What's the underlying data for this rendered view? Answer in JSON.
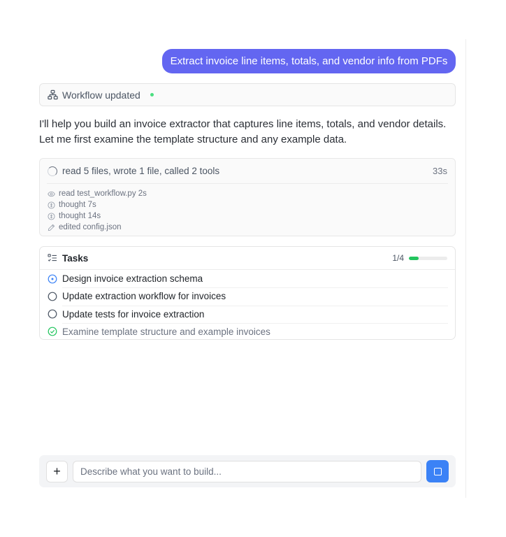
{
  "conversation": {
    "user_message": "Extract invoice line items, totals, and vendor info from PDFs",
    "workflow_status": {
      "label": "Workflow updated",
      "icon": "workflow-icon",
      "status_color": "#4ade80"
    },
    "assistant_message": "I'll help you build an invoice extractor that captures line items, totals, and vendor details. Let me first examine the template structure and any example data."
  },
  "activity": {
    "summary": "read 5 files, wrote 1 file, called 2 tools",
    "duration": "33s",
    "items": [
      {
        "icon": "eye-icon",
        "label": "read test_workflow.py 2s"
      },
      {
        "icon": "thought-icon",
        "label": "thought 7s"
      },
      {
        "icon": "thought-icon",
        "label": "thought 14s"
      },
      {
        "icon": "pencil-icon",
        "label": "edited config.json"
      }
    ]
  },
  "tasks": {
    "title": "Tasks",
    "count": "1/4",
    "progress": 0.25,
    "items": [
      {
        "label": "Design invoice extraction schema",
        "status": "in-progress"
      },
      {
        "label": "Update extraction workflow for invoices",
        "status": "pending"
      },
      {
        "label": "Update tests for invoice extraction",
        "status": "pending"
      },
      {
        "label": "Examine template structure and example invoices",
        "status": "done"
      }
    ]
  },
  "composer": {
    "add_label": "+",
    "placeholder": "Describe what you want to build...",
    "value": ""
  },
  "colors": {
    "user_bubble": "#6366f1",
    "send_button": "#3b82f6",
    "progress": "#22c55e",
    "in_progress": "#3b82f6",
    "done": "#22c55e"
  }
}
